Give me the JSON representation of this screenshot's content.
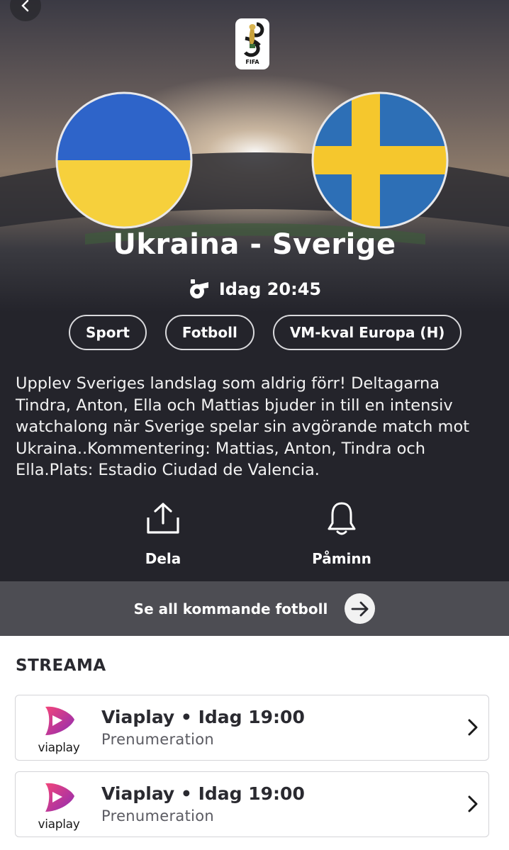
{
  "nav": {
    "back_icon": "chevron-left-icon"
  },
  "logo": {
    "text": "FIFA",
    "icon": "world-cup-trophy-icon"
  },
  "match": {
    "home_flag": "ukraine-flag",
    "away_flag": "sweden-flag",
    "title": "Ukraina - Sverige",
    "time_icon": "whistle-icon",
    "time": "Idag 20:45",
    "tags": [
      "Sport",
      "Fotboll",
      "VM-kval Europa (H)"
    ],
    "description": "Upplev Sveriges landslag som aldrig förr! Deltagarna Tindra, Anton, Ella och Mattias bjuder in till en intensiv watchalong när Sverige spelar sin avgörande match mot Ukraina..Kommentering: Mattias, Anton, Tindra och Ella.Plats: Estadio Ciudad de Valencia."
  },
  "actions": {
    "share_label": "Dela",
    "share_icon": "share-icon",
    "remind_label": "Påminn",
    "remind_icon": "bell-icon"
  },
  "see_all": {
    "label": "Se all kommande fotboll",
    "icon": "arrow-right-icon"
  },
  "stream": {
    "heading": "STREAMA",
    "providers": [
      {
        "logo_text": "viaplay",
        "title": "Viaplay • Idag 19:00",
        "subtitle": "Prenumeration"
      },
      {
        "logo_text": "viaplay",
        "title": "Viaplay • Idag 19:00",
        "subtitle": "Prenumeration"
      }
    ]
  },
  "colors": {
    "ukraine_blue": "#2e64c9",
    "ukraine_yellow": "#f6d03c",
    "sweden_blue": "#2d6fb6",
    "sweden_yellow": "#f5c72d",
    "viaplay_pink": "#ea3a73",
    "viaplay_purple": "#9a2fb0"
  }
}
